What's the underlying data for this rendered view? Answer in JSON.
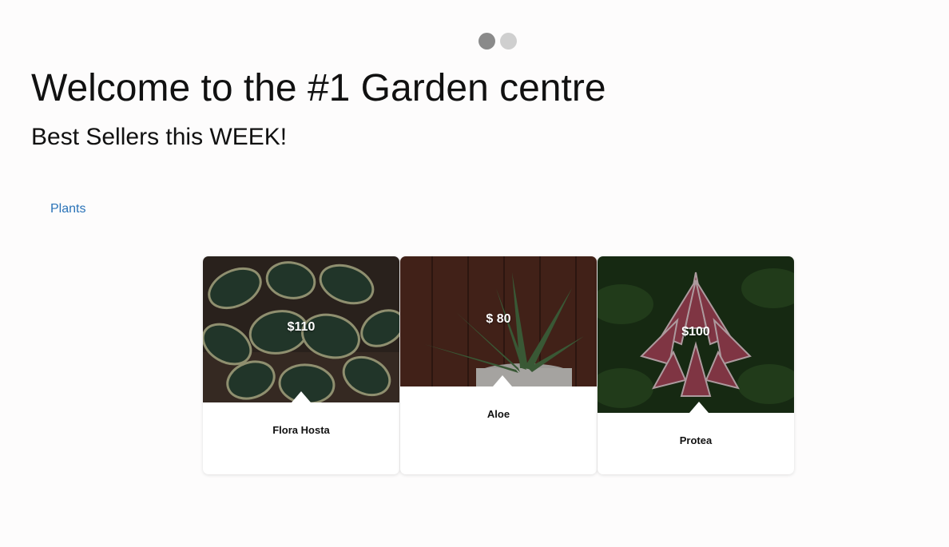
{
  "carousel": {
    "dots": [
      {
        "state": "active"
      },
      {
        "state": "inactive"
      }
    ]
  },
  "header": {
    "title": "Welcome to the #1 Garden centre",
    "subtitle": "Best Sellers this WEEK!"
  },
  "nav": {
    "plants_link": "Plants"
  },
  "products": [
    {
      "name": "Flora Hosta",
      "price": "$110",
      "image": "hosta-plant-photo"
    },
    {
      "name": "Aloe",
      "price": "$ 80",
      "image": "aloe-plant-photo"
    },
    {
      "name": "Protea",
      "price": "$100",
      "image": "protea-flower-photo"
    }
  ],
  "colors": {
    "link": "#2a73b8",
    "dot_active": "#8a8a8a",
    "dot_inactive": "#cfcfcf",
    "background": "#fdfcfc"
  }
}
